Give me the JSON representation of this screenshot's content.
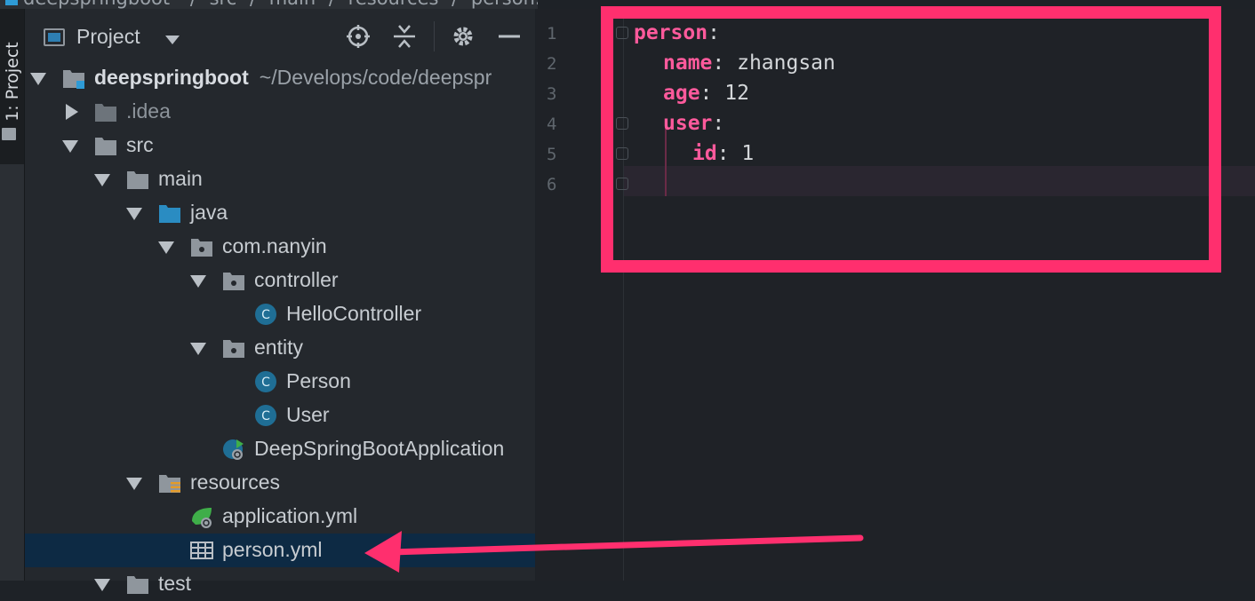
{
  "breadcrumb": {
    "items": [
      "deepspringboot",
      "src",
      "main",
      "resources",
      "person.yml"
    ]
  },
  "toolstrip": {
    "project_tab_label": "1: Project"
  },
  "project_panel": {
    "title": "Project",
    "icons": [
      "locate-icon",
      "collapse-icon",
      "gear-icon",
      "minimize-icon"
    ],
    "tree": [
      {
        "label": "deepspringboot",
        "path": "~/Develops/code/deepspr",
        "level": 0,
        "expanded": true,
        "icon": "project-module-icon"
      },
      {
        "label": ".idea",
        "level": 1,
        "expanded": false,
        "icon": "folder-icon"
      },
      {
        "label": "src",
        "level": 1,
        "expanded": true,
        "icon": "folder-icon"
      },
      {
        "label": "main",
        "level": 2,
        "expanded": true,
        "icon": "folder-icon"
      },
      {
        "label": "java",
        "level": 3,
        "expanded": true,
        "icon": "source-folder-icon"
      },
      {
        "label": "com.nanyin",
        "level": 4,
        "expanded": true,
        "icon": "package-icon"
      },
      {
        "label": "controller",
        "level": 5,
        "expanded": true,
        "icon": "package-icon"
      },
      {
        "label": "HelloController",
        "level": 6,
        "icon": "class-icon"
      },
      {
        "label": "entity",
        "level": 5,
        "expanded": true,
        "icon": "package-icon"
      },
      {
        "label": "Person",
        "level": 6,
        "icon": "class-icon"
      },
      {
        "label": "User",
        "level": 6,
        "icon": "class-icon"
      },
      {
        "label": "DeepSpringBootApplication",
        "level": 5,
        "icon": "spring-boot-class-icon"
      },
      {
        "label": "resources",
        "level": 3,
        "expanded": true,
        "icon": "resources-folder-icon"
      },
      {
        "label": "application.yml",
        "level": 4,
        "icon": "spring-config-icon"
      },
      {
        "label": "person.yml",
        "level": 4,
        "icon": "yaml-file-icon",
        "selected": true
      },
      {
        "label": "test",
        "level": 2,
        "expanded": true,
        "icon": "folder-icon"
      }
    ]
  },
  "editor": {
    "file": "person.yml",
    "line_numbers": [
      "1",
      "2",
      "3",
      "4",
      "5",
      "6"
    ],
    "lines": [
      {
        "key": "person",
        "sep": ":",
        "value": ""
      },
      {
        "key": "name",
        "sep": ": ",
        "value": "zhangsan"
      },
      {
        "key": "age",
        "sep": ": ",
        "value": "12"
      },
      {
        "key": "user",
        "sep": ":",
        "value": ""
      },
      {
        "key": "id",
        "sep": ": ",
        "value": "1"
      },
      {
        "key": "",
        "sep": "",
        "value": ""
      }
    ]
  },
  "colors": {
    "annotation": "#ff2f6e",
    "yaml_key": "#ff5a9c",
    "selection": "#0d2a44"
  }
}
